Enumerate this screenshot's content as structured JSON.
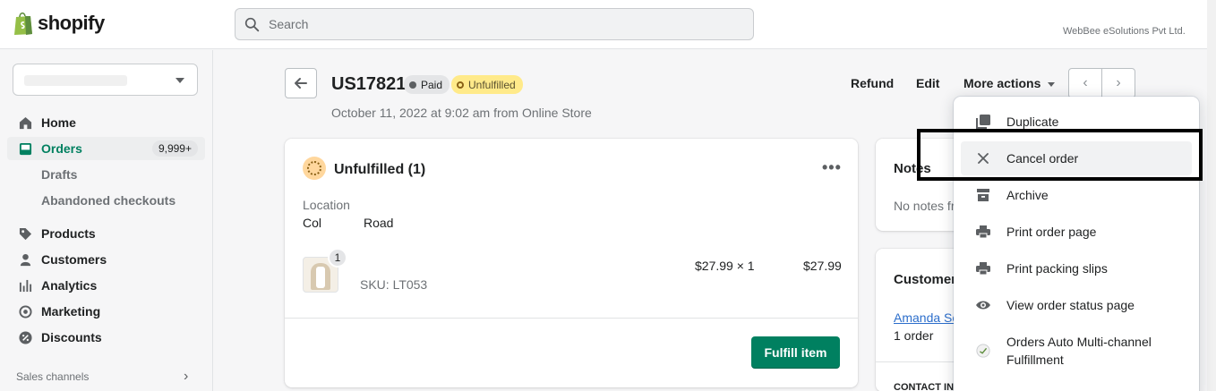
{
  "topbar": {
    "logo_text": "shopify",
    "search_placeholder": "Search",
    "store_name": "WebBee eSolutions Pvt Ltd."
  },
  "sidebar": {
    "items": [
      {
        "label": "Home",
        "icon": "home-icon"
      },
      {
        "label": "Orders",
        "icon": "orders-icon",
        "badge": "9,999+",
        "active": true
      },
      {
        "label": "Drafts",
        "sub": true
      },
      {
        "label": "Abandoned checkouts",
        "sub": true
      },
      {
        "label": "Products",
        "icon": "tag-icon"
      },
      {
        "label": "Customers",
        "icon": "person-icon"
      },
      {
        "label": "Analytics",
        "icon": "bar-chart-icon"
      },
      {
        "label": "Marketing",
        "icon": "target-icon"
      },
      {
        "label": "Discounts",
        "icon": "discount-icon"
      }
    ],
    "sales_channels_label": "Sales channels"
  },
  "header": {
    "order_id": "US17821",
    "paid_badge": "Paid",
    "unfulfilled_badge": "Unfulfilled",
    "meta": "October 11, 2022 at 9:02 am from Online Store",
    "refund_label": "Refund",
    "edit_label": "Edit",
    "more_actions_label": "More actions"
  },
  "fulfillment_card": {
    "title": "Unfulfilled (1)",
    "location_label": "Location",
    "location_part1": "Col",
    "location_part2": "Road",
    "item_qty": "1",
    "item_sku": "SKU: LT053",
    "price_qty": "$27.99 × 1",
    "total": "$27.99",
    "fulfill_button": "Fulfill item"
  },
  "notes_card": {
    "title": "Notes",
    "text": "No notes fr"
  },
  "customer_card": {
    "title": "Customer",
    "name": "Amanda Sc",
    "orders": "1 order",
    "contact_label": "CONTACT IN"
  },
  "more_actions_menu": [
    {
      "label": "Duplicate",
      "icon": "duplicate-icon"
    },
    {
      "label": "Cancel order",
      "icon": "close-icon",
      "highlighted": true
    },
    {
      "label": "Archive",
      "icon": "archive-icon"
    },
    {
      "label": "Print order page",
      "icon": "printer-icon"
    },
    {
      "label": "Print packing slips",
      "icon": "printer-icon"
    },
    {
      "label": "View order status page",
      "icon": "eye-icon"
    },
    {
      "label": "Orders Auto Multi-channel Fulfillment",
      "icon": "app-icon"
    }
  ],
  "colors": {
    "brand_green": "#008060",
    "paid_badge_bg": "#e4e5e7",
    "unfulfilled_badge_bg": "#ffea8a"
  }
}
